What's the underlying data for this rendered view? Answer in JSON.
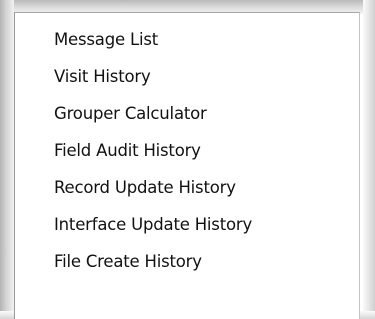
{
  "menu": {
    "items": [
      {
        "label": "Message List"
      },
      {
        "label": "Visit History"
      },
      {
        "label": "Grouper Calculator"
      },
      {
        "label": "Field Audit History"
      },
      {
        "label": "Record Update History"
      },
      {
        "label": "Interface Update History"
      },
      {
        "label": "File Create History"
      }
    ]
  }
}
